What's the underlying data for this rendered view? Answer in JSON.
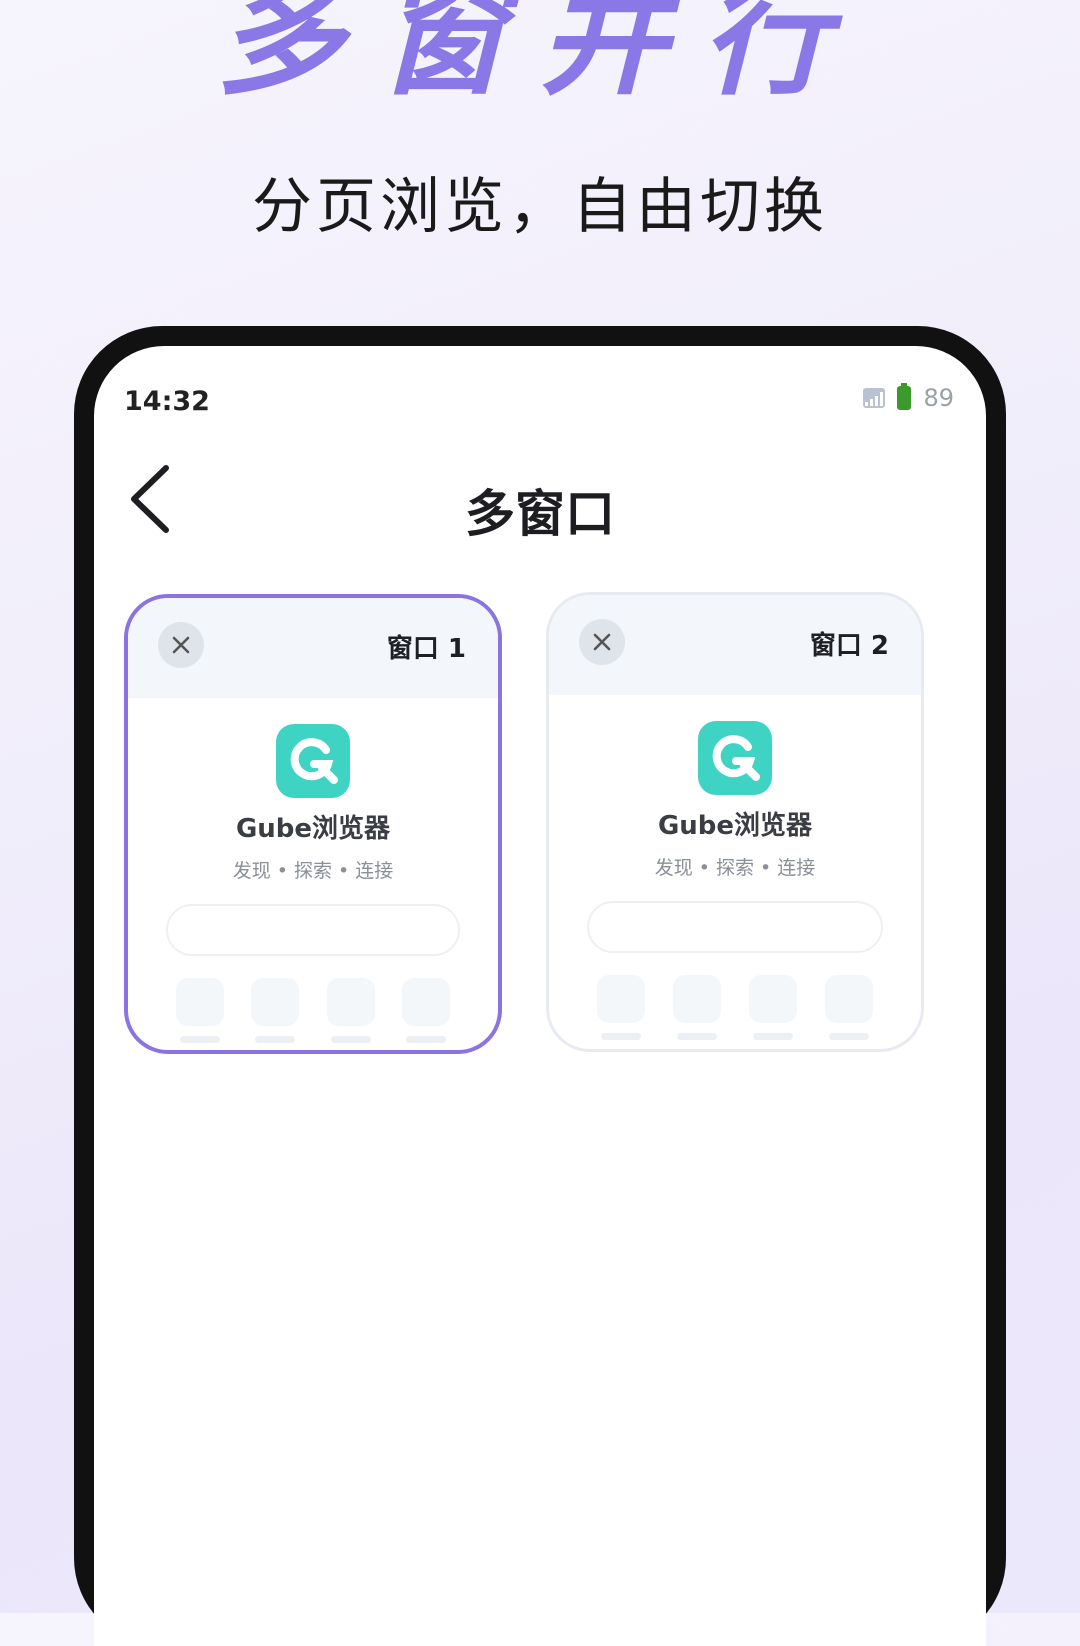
{
  "hero": {
    "title": "多窗并行",
    "subtitle": "分页浏览，自由切换"
  },
  "status_bar": {
    "time": "14:32",
    "battery": "89",
    "icons": [
      "signal-icon",
      "battery-icon"
    ]
  },
  "header": {
    "title": "多窗口",
    "back_icon": "chevron-left-icon"
  },
  "colors": {
    "accent": "#8b74e2",
    "logo": "#3ed3c2",
    "title_purple": "#8a78e6"
  },
  "windows": [
    {
      "label": "窗口 1",
      "active": true,
      "brand": "Gube浏览器",
      "slogan": "发现 • 探索 • 连接"
    },
    {
      "label": "窗口 2",
      "active": false,
      "brand": "Gube浏览器",
      "slogan": "发现 • 探索 • 连接"
    }
  ]
}
